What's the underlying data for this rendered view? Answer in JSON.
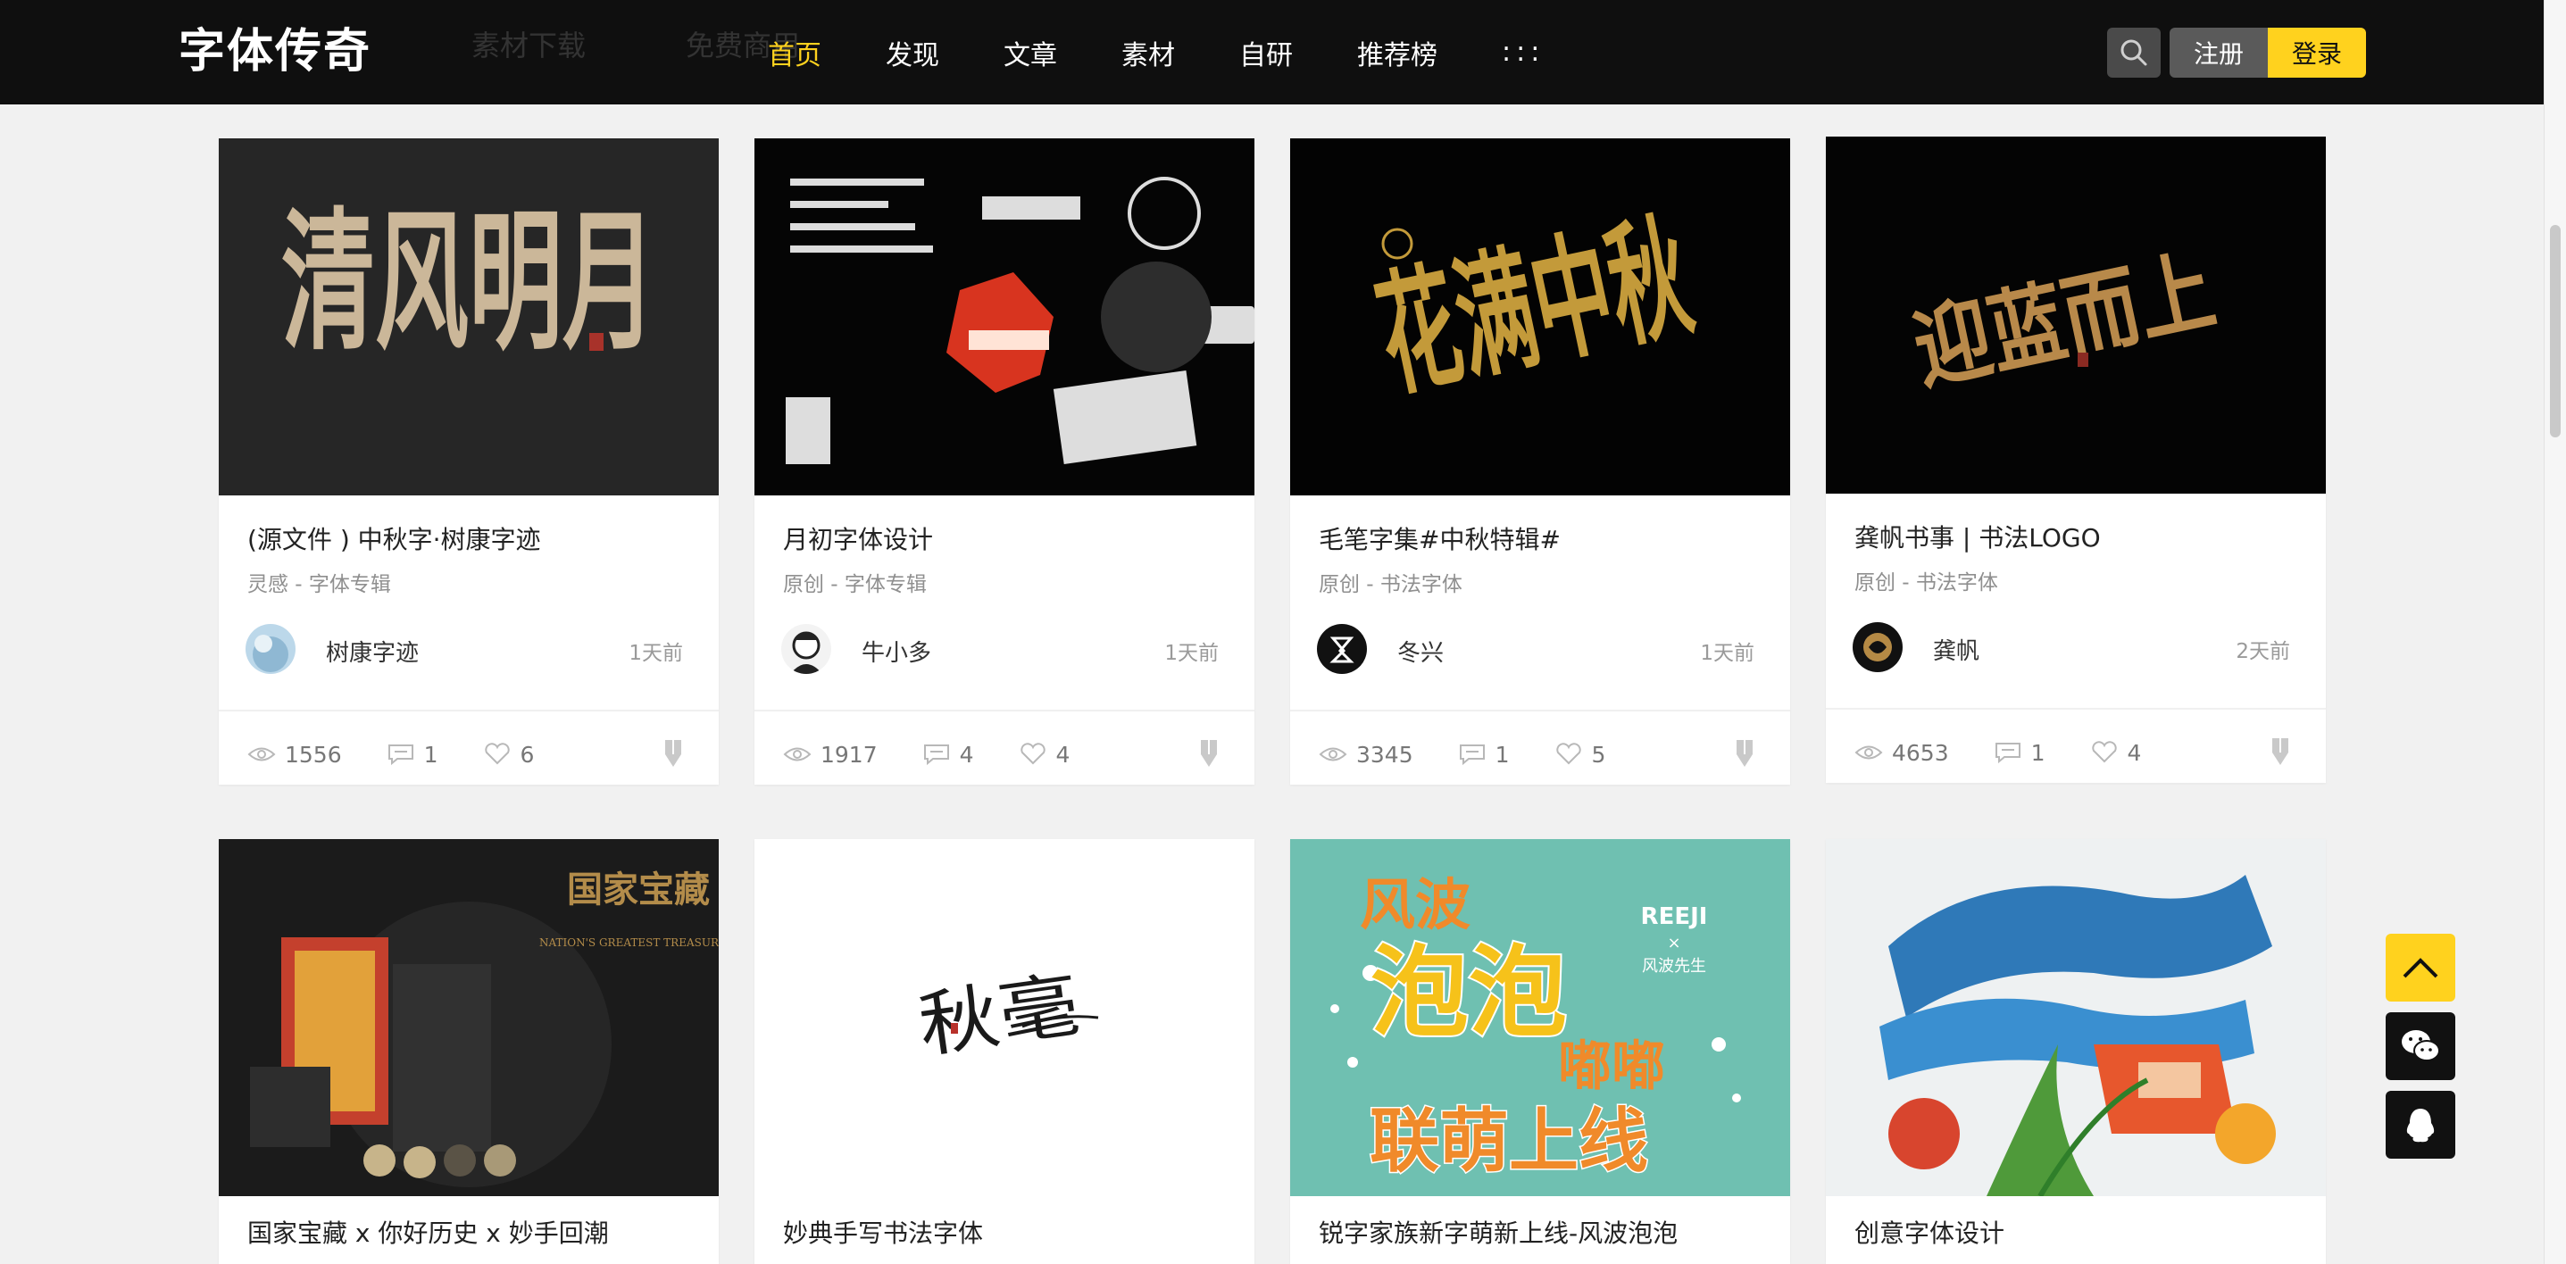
{
  "header": {
    "logo": "字体传奇",
    "ghost_links": [
      "素材下载",
      "免费商用"
    ],
    "nav": [
      {
        "label": "首页",
        "active": true
      },
      {
        "label": "发现",
        "active": false
      },
      {
        "label": "文章",
        "active": false
      },
      {
        "label": "素材",
        "active": false
      },
      {
        "label": "自研",
        "active": false
      },
      {
        "label": "推荐榜",
        "active": false
      },
      {
        "label": ":::",
        "active": false
      }
    ],
    "register": "注册",
    "login": "登录"
  },
  "colors": {
    "accent": "#ffd21e",
    "header_bg": "#0f0f0f",
    "page_bg": "#f1f1f1"
  },
  "cards": [
    {
      "title": "(源文件 ) 中秋字·树康字迹",
      "category": "灵感 - 字体专辑",
      "author": "树康字迹",
      "time": "1天前",
      "views": "1556",
      "comments": "1",
      "likes": "6"
    },
    {
      "title": "月初字体设计",
      "category": "原创 - 字体专辑",
      "author": "牛小多",
      "time": "1天前",
      "views": "1917",
      "comments": "4",
      "likes": "4"
    },
    {
      "title": "毛笔字集#中秋特辑#",
      "category": "原创 - 书法字体",
      "author": "冬兴",
      "time": "1天前",
      "views": "3345",
      "comments": "1",
      "likes": "5"
    },
    {
      "title": "龚帆书事 | 书法LOGO",
      "category": "原创 - 书法字体",
      "author": "龚帆",
      "time": "2天前",
      "views": "4653",
      "comments": "1",
      "likes": "4"
    },
    {
      "title": "国家宝藏 x 你好历史 x 妙手回潮"
    },
    {
      "title": "妙典手写书法字体"
    },
    {
      "title": "锐字家族新字萌新上线-风波泡泡"
    },
    {
      "title": "创意字体设计"
    }
  ],
  "artwork": {
    "card1": "清风明月",
    "card3": "花满中秋",
    "card4": "迎蓝而上",
    "card5_brand": "国家宝藏",
    "card5_sub": "NATION'S GREATEST TREASURES",
    "card6": "秋毫",
    "card7_top": "风波",
    "card7_mid": "泡泡",
    "card7_dd": "嘟嘟",
    "card7_bottom": "联萌上线",
    "card7_brand": "REEJI",
    "card7_x": "×",
    "card7_sub": "风波先生"
  },
  "icons": {
    "search": "search-icon",
    "back_to_top": "chevron-up-icon",
    "wechat": "wechat-icon",
    "qq": "qq-icon"
  }
}
